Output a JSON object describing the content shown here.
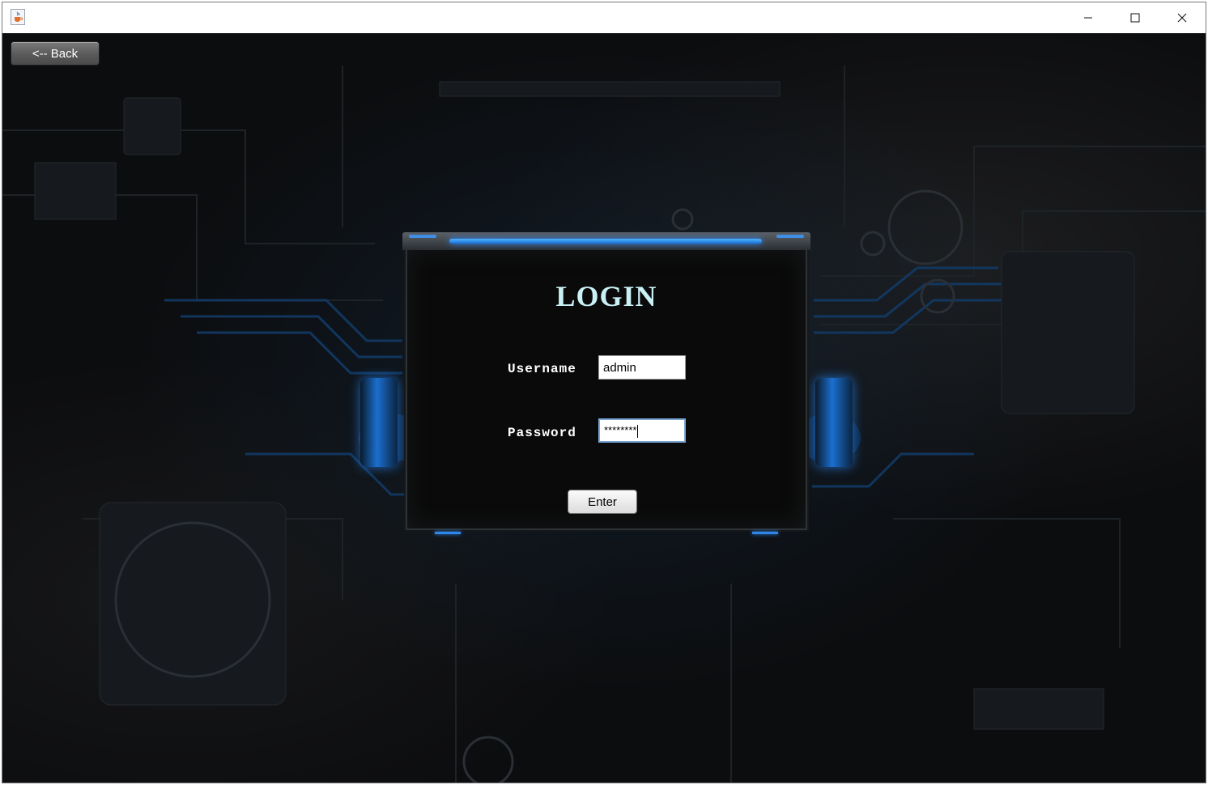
{
  "window": {
    "icon": "java-cup-icon",
    "controls": {
      "minimize_icon": "minimize-icon",
      "maximize_icon": "maximize-icon",
      "close_icon": "close-icon"
    }
  },
  "toolbar": {
    "back_label": "<-- Back"
  },
  "login": {
    "title": "LOGIN",
    "username_label": "Username",
    "username_value": "admin",
    "password_label": "Password",
    "password_value": "********",
    "enter_label": "Enter"
  },
  "colors": {
    "title_text": "#c9f0f5",
    "accent_blue": "#2f86e8",
    "background": "#0c0d0f"
  }
}
